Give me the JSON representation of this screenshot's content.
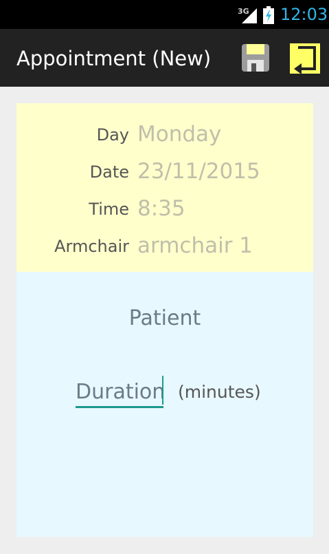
{
  "status_bar": {
    "network": "3G",
    "time": "12:03",
    "clock_color": "#33b5e5"
  },
  "action_bar": {
    "title": "Appointment (New)",
    "save_icon": "save-icon",
    "back_icon": "enter-return-icon",
    "back_button_color": "#ffff66"
  },
  "appointment": {
    "fields": [
      {
        "label": "Day",
        "value": "Monday"
      },
      {
        "label": "Date",
        "value": "23/11/2015"
      },
      {
        "label": "Time",
        "value": "8:35"
      },
      {
        "label": "Armchair",
        "value": "armchair 1"
      }
    ],
    "panel_color": "#ffffcc"
  },
  "patient": {
    "label": "Patient",
    "duration_placeholder": "Duration",
    "duration_unit": "(minutes)",
    "panel_color": "#e8f8ff",
    "accent": "#1b9a8d"
  }
}
